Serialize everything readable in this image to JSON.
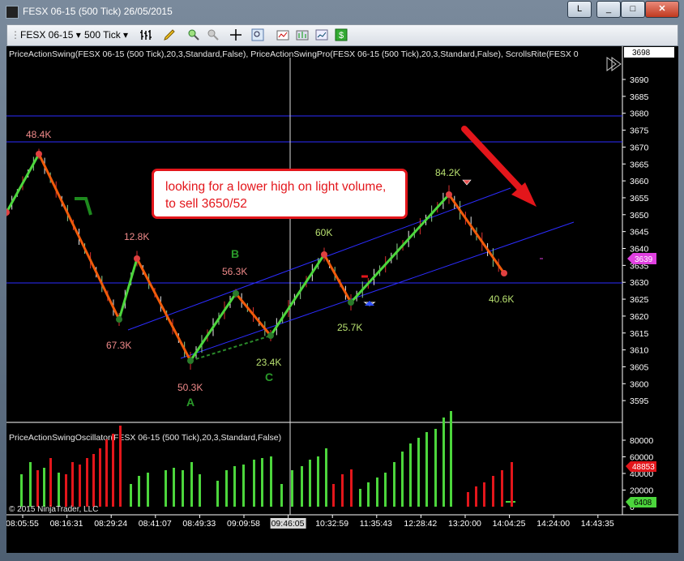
{
  "window": {
    "title": "FESX 06-15 (500 Tick)  26/05/2015",
    "controls": {
      "layout": "L",
      "minimize": "_",
      "maximize": "□",
      "close": "✕"
    }
  },
  "toolbar": {
    "instrument": "FESX 06-15",
    "interval": "500 Tick",
    "icons": [
      "bar-type-icon",
      "drawing-pencil-icon",
      "zoom-in-icon",
      "zoom-out-icon",
      "crosshair-icon",
      "magnifier-icon",
      "indicators-icon",
      "strategies-icon",
      "properties-icon",
      "dollar-icon"
    ]
  },
  "chart": {
    "indicator_caption": "PriceActionSwing(FESX 06-15 (500 Tick),20,3,Standard,False), PriceActionSwingPro(FESX 06-15 (500 Tick),20,3,Standard,False), ScrollsRite(FESX 0",
    "annotation": {
      "line1": "looking for a lower high on light volume,",
      "line2": "to sell 3650/52"
    },
    "price_axis": [
      "3690",
      "3685",
      "3680",
      "3675",
      "3670",
      "3665",
      "3660",
      "3655",
      "3650",
      "3645",
      "3640",
      "3635",
      "3630",
      "3625",
      "3620",
      "3615",
      "3610",
      "3605",
      "3600",
      "3595"
    ],
    "price_top_badge": "3698",
    "price_last_badge": "3639",
    "swing_labels": {
      "s1": "48.4K",
      "s2": "12.8K",
      "s3": "67.3K",
      "s4": "50.3K",
      "s5": "56.3K",
      "s6": "23.4K",
      "s7": "60K",
      "s8": "25.7K",
      "s9": "84.2K",
      "s10": "40.6K"
    },
    "wave_labels": {
      "a": "A",
      "b": "B",
      "c": "C"
    }
  },
  "oscillator": {
    "caption": "PriceActionSwingOscillator(FESX 06-15 (500 Tick),20,3,Standard,False)",
    "axis": [
      "80000",
      "60000",
      "40000",
      "20000",
      "0"
    ],
    "badge_red": "48853",
    "badge_green": "6408",
    "copyright": "© 2015 NinjaTrader, LLC"
  },
  "time_axis": [
    "08:05:55",
    "08:16:31",
    "08:29:24",
    "08:41:07",
    "08:49:33",
    "09:09:58",
    "09:46:05",
    "10:32:59",
    "11:35:43",
    "12:28:42",
    "13:20:00",
    "14:04:25",
    "14:24:00",
    "14:43:35"
  ],
  "colors": {
    "up": "#4cd63c",
    "down": "#f05a0a",
    "accent_red": "#e3161b",
    "channel_blue": "#2c2cff"
  }
}
